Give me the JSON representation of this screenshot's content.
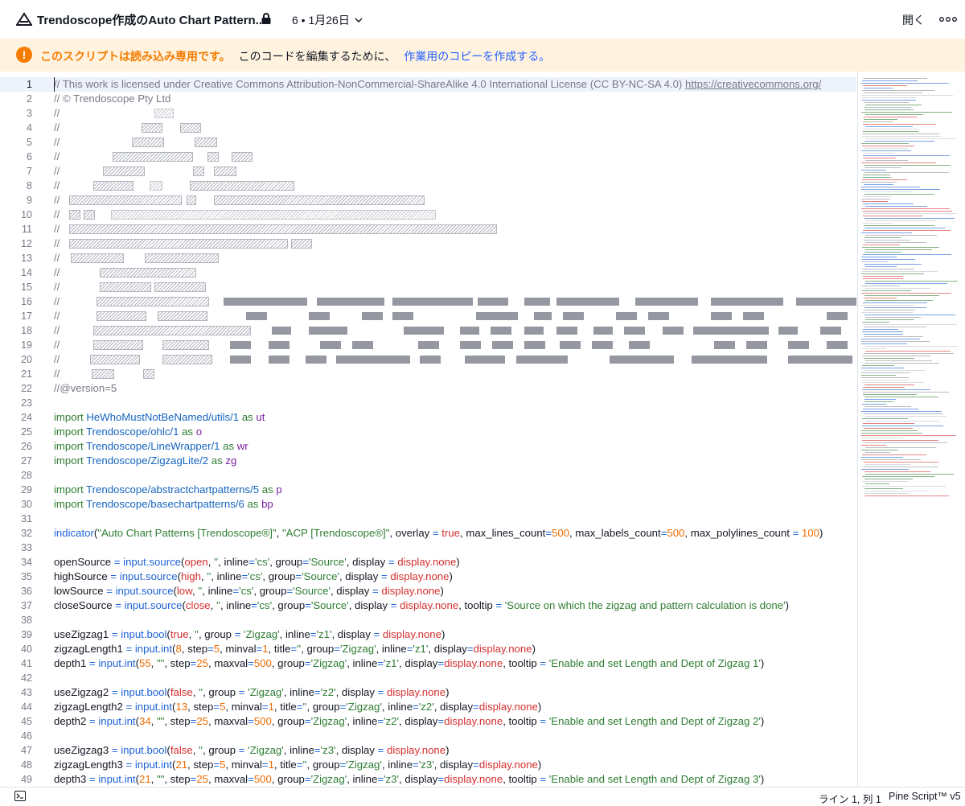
{
  "header": {
    "title": "Trendoscope作成のAuto Chart Pattern...",
    "version_label": "6 • 1月26日",
    "open_label": "開く"
  },
  "banner": {
    "strong_text": "このスクリプトは読み込み専用です。",
    "plain_text": "このコードを編集するために、",
    "link_text": "作業用のコピーを作成する。"
  },
  "status": {
    "position": "ライン 1, 列 1",
    "language": "Pine Script™ v5"
  },
  "colors": {
    "accent_orange": "#f57c00",
    "link_blue": "#2962ff",
    "banner_bg": "#fff3e0"
  },
  "editor": {
    "current_line": 1,
    "lines": [
      {
        "n": "1",
        "text": "// This work is licensed under Creative Commons Attribution-NonCommercial-ShareAlike 4.0 International License (CC BY-NC-SA 4.0) https://creativecommons.org/"
      },
      {
        "n": "2",
        "text": "// © Trendoscope Pty Ltd"
      },
      {
        "n": "3",
        "text": "//"
      },
      {
        "n": "4",
        "text": "//"
      },
      {
        "n": "5",
        "text": "//"
      },
      {
        "n": "6",
        "text": "//"
      },
      {
        "n": "7",
        "text": "//"
      },
      {
        "n": "8",
        "text": "//"
      },
      {
        "n": "9",
        "text": "//"
      },
      {
        "n": "10",
        "text": "//"
      },
      {
        "n": "11",
        "text": "//"
      },
      {
        "n": "12",
        "text": "//"
      },
      {
        "n": "13",
        "text": "//"
      },
      {
        "n": "14",
        "text": "//"
      },
      {
        "n": "15",
        "text": "//"
      },
      {
        "n": "16",
        "text": "//"
      },
      {
        "n": "17",
        "text": "//"
      },
      {
        "n": "18",
        "text": "//"
      },
      {
        "n": "19",
        "text": "//"
      },
      {
        "n": "20",
        "text": "//"
      },
      {
        "n": "21",
        "text": "//"
      },
      {
        "n": "22",
        "text": "//@version=5"
      },
      {
        "n": "23",
        "text": ""
      },
      {
        "n": "24",
        "text": "import HeWhoMustNotBeNamed/utils/1 as ut"
      },
      {
        "n": "25",
        "text": "import Trendoscope/ohlc/1 as o"
      },
      {
        "n": "26",
        "text": "import Trendoscope/LineWrapper/1 as wr"
      },
      {
        "n": "27",
        "text": "import Trendoscope/ZigzagLite/2 as zg"
      },
      {
        "n": "28",
        "text": ""
      },
      {
        "n": "29",
        "text": "import Trendoscope/abstractchartpatterns/5 as p"
      },
      {
        "n": "30",
        "text": "import Trendoscope/basechartpatterns/6 as bp"
      },
      {
        "n": "31",
        "text": ""
      },
      {
        "n": "32",
        "text": "indicator(\"Auto Chart Patterns [Trendoscope®]\", \"ACP [Trendoscope®]\", overlay = true, max_lines_count=500, max_labels_count=500, max_polylines_count = 100)"
      },
      {
        "n": "33",
        "text": ""
      },
      {
        "n": "34",
        "text": "openSource = input.source(open, '', inline='cs', group='Source', display = display.none)"
      },
      {
        "n": "35",
        "text": "highSource = input.source(high, '', inline='cs', group='Source', display = display.none)"
      },
      {
        "n": "36",
        "text": "lowSource = input.source(low, '', inline='cs', group='Source', display = display.none)"
      },
      {
        "n": "37",
        "text": "closeSource = input.source(close, '', inline='cs', group='Source', display = display.none, tooltip = 'Source on which the zigzag and pattern calculation is done')"
      },
      {
        "n": "38",
        "text": ""
      },
      {
        "n": "39",
        "text": "useZigzag1 = input.bool(true, '', group = 'Zigzag', inline='z1', display = display.none)"
      },
      {
        "n": "40",
        "text": "zigzagLength1 = input.int(8, step=5, minval=1, title='', group='Zigzag', inline='z1', display=display.none)"
      },
      {
        "n": "41",
        "text": "depth1 = input.int(55, \"\", step=25, maxval=500, group='Zigzag', inline='z1', display=display.none, tooltip = 'Enable and set Length and Dept of Zigzag 1')"
      },
      {
        "n": "42",
        "text": ""
      },
      {
        "n": "43",
        "text": "useZigzag2 = input.bool(false, '', group = 'Zigzag', inline='z2', display = display.none)"
      },
      {
        "n": "44",
        "text": "zigzagLength2 = input.int(13, step=5, minval=1, title='', group='Zigzag', inline='z2', display=display.none)"
      },
      {
        "n": "45",
        "text": "depth2 = input.int(34, \"\", step=25, maxval=500, group='Zigzag', inline='z2', display=display.none, tooltip = 'Enable and set Length and Dept of Zigzag 2')"
      },
      {
        "n": "46",
        "text": ""
      },
      {
        "n": "47",
        "text": "useZigzag3 = input.bool(false, '', group = 'Zigzag', inline='z3', display = display.none)"
      },
      {
        "n": "48",
        "text": "zigzagLength3 = input.int(21, step=5, minval=1, title='', group='Zigzag', inline='z3', display=display.none)"
      },
      {
        "n": "49",
        "text": "depth3 = input.int(21, \"\", step=25, maxval=500, group='Zigzag', inline='z3', display=display.none, tooltip = 'Enable and set Length and Dept of Zigzag 3')"
      }
    ]
  }
}
